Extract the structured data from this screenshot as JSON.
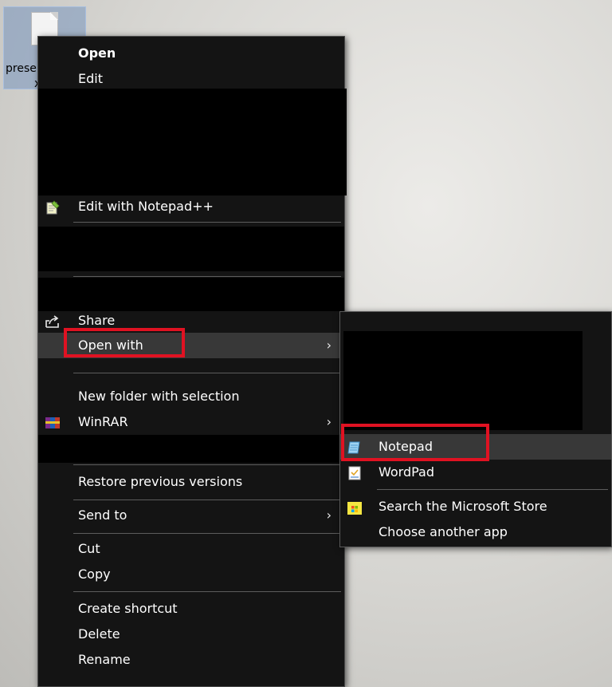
{
  "desktop": {
    "file_label_line1": "prese",
    "file_label_line2": "x"
  },
  "context_menu": {
    "items": {
      "open": "Open",
      "edit": "Edit",
      "edit_notepadpp": "Edit with Notepad++",
      "share": "Share",
      "open_with": "Open with",
      "new_folder": "New folder with selection",
      "winrar": "WinRAR",
      "restore": "Restore previous versions",
      "send_to": "Send to",
      "cut": "Cut",
      "copy": "Copy",
      "create_shortcut": "Create shortcut",
      "delete": "Delete",
      "rename": "Rename"
    },
    "submenu_arrow": "›"
  },
  "open_with_submenu": {
    "notepad": "Notepad",
    "wordpad": "WordPad",
    "store": "Search the Microsoft Store",
    "choose": "Choose another app"
  },
  "colors": {
    "menu_bg": "#141414",
    "highlight": "#383838",
    "annotation_red": "#e01222"
  },
  "icons": {
    "notepadpp": "notepadpp-icon",
    "share": "share-icon",
    "winrar": "winrar-icon",
    "notepad": "notepad-icon",
    "wordpad": "wordpad-icon",
    "store": "store-icon"
  }
}
